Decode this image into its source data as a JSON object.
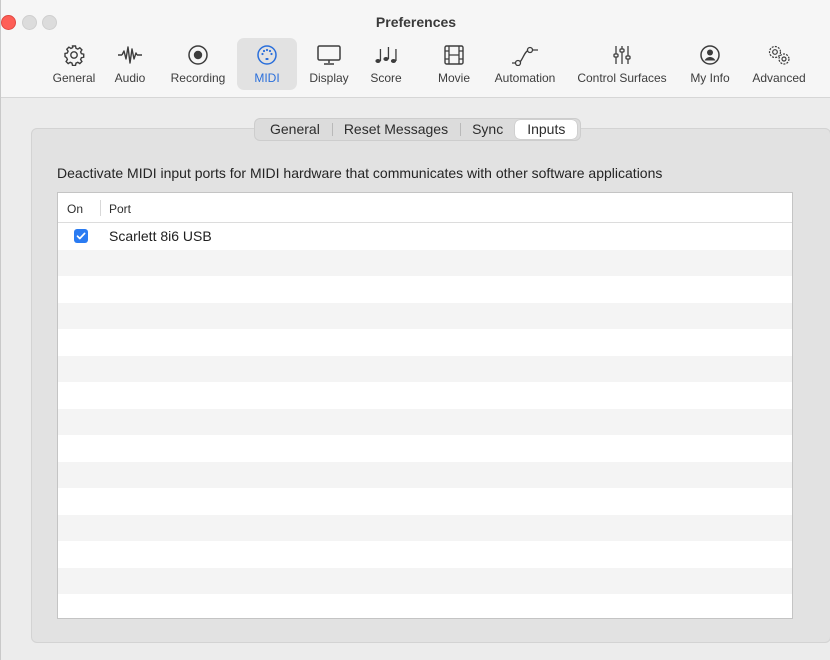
{
  "window": {
    "title": "Preferences"
  },
  "toolbar": {
    "items": [
      {
        "label": "General",
        "icon": "gear-icon"
      },
      {
        "label": "Audio",
        "icon": "waveform-icon"
      },
      {
        "label": "Recording",
        "icon": "record-icon"
      },
      {
        "label": "MIDI",
        "icon": "midi-port-icon",
        "active": true
      },
      {
        "label": "Display",
        "icon": "display-icon"
      },
      {
        "label": "Score",
        "icon": "music-notes-icon"
      },
      {
        "label": "Movie",
        "icon": "film-icon"
      },
      {
        "label": "Automation",
        "icon": "automation-curve-icon"
      },
      {
        "label": "Control Surfaces",
        "icon": "faders-icon"
      },
      {
        "label": "My Info",
        "icon": "person-icon"
      },
      {
        "label": "Advanced",
        "icon": "gears-icon"
      }
    ]
  },
  "tabs": {
    "items": [
      {
        "label": "General"
      },
      {
        "label": "Reset Messages"
      },
      {
        "label": "Sync"
      },
      {
        "label": "Inputs",
        "active": true
      }
    ]
  },
  "inputs": {
    "description": "Deactivate MIDI input ports for MIDI hardware that communicates with other software applications",
    "columns": {
      "on": "On",
      "port": "Port"
    },
    "ports": [
      {
        "on": true,
        "name": "Scarlett 8i6 USB"
      }
    ]
  },
  "colors": {
    "accent": "#2a7bf2",
    "close_button": "#fe5f57"
  }
}
